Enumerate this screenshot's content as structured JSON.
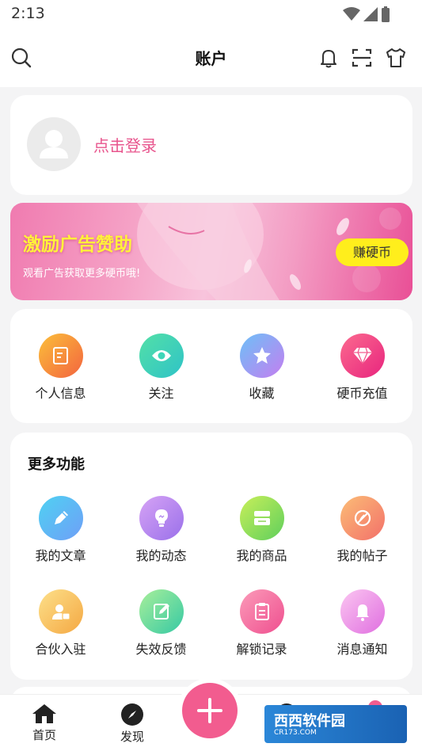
{
  "status_bar": {
    "time": "2:13"
  },
  "header": {
    "title": "账户"
  },
  "login": {
    "prompt": "点击登录"
  },
  "banner": {
    "title": "激励广告赞助",
    "subtitle": "观看广告获取更多硬币哦!",
    "button": "赚硬币"
  },
  "quick_actions": [
    {
      "label": "个人信息",
      "icon": "edit-note-icon",
      "color": "#f7a437"
    },
    {
      "label": "关注",
      "icon": "eye-icon",
      "color": "#3dd6b8"
    },
    {
      "label": "收藏",
      "icon": "star-icon",
      "color": "#8f9bf6"
    },
    {
      "label": "硬币充值",
      "icon": "diamond-icon",
      "color": "#f25c8f"
    }
  ],
  "more": {
    "title": "更多功能",
    "items": [
      {
        "label": "我的文章",
        "icon": "pencil-icon",
        "color": "#5fb8f6"
      },
      {
        "label": "我的动态",
        "icon": "lightbulb-icon",
        "color": "#b58df0"
      },
      {
        "label": "我的商品",
        "icon": "shop-icon",
        "color": "#8fd25a"
      },
      {
        "label": "我的帖子",
        "icon": "no-edit-icon",
        "color": "#f79a73"
      },
      {
        "label": "合伙入驻",
        "icon": "user-badge-icon",
        "color": "#f9c262"
      },
      {
        "label": "失效反馈",
        "icon": "feedback-edit-icon",
        "color": "#6ed7a2"
      },
      {
        "label": "解锁记录",
        "icon": "clipboard-icon",
        "color": "#f57cae"
      },
      {
        "label": "消息通知",
        "icon": "bell-icon",
        "color": "#f29ae6"
      }
    ]
  },
  "tabbar": {
    "items": [
      {
        "label": "首页",
        "icon": "home-icon"
      },
      {
        "label": "发现",
        "icon": "compass-icon"
      }
    ],
    "fab_icon": "plus-icon"
  },
  "watermark": {
    "text": "西西软件园",
    "sub": "CR173.COM"
  }
}
